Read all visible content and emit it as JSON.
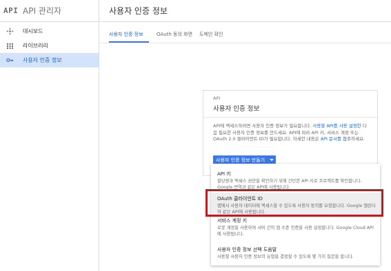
{
  "app": {
    "logo": "API",
    "title": "API 관리자"
  },
  "sidebar": {
    "items": [
      {
        "label": "대시보드",
        "icon": "dashboard-icon",
        "active": false
      },
      {
        "label": "라이브러리",
        "icon": "library-icon",
        "active": false
      },
      {
        "label": "사용자 인증 정보",
        "icon": "key-icon",
        "active": true
      }
    ]
  },
  "header": {
    "title": "사용자 인증 정보"
  },
  "tabs": [
    {
      "label": "사용자 인증 정보",
      "active": true
    },
    {
      "label": "OAuth 동의 화면",
      "active": false
    },
    {
      "label": "도메인 확인",
      "active": false
    }
  ],
  "card": {
    "kicker": "API",
    "title": "사용자 인증 정보",
    "body_pre": "API에 액세스하려면 사용자 인증 정보가 필요합니다. ",
    "body_link1": "사용할 API를 사용 설정한",
    "body_mid": " 다음 필요한 사용자 인증 정보를 만드세요. API에 따라 API 키, 서비스 계정 또는 OAuth 2.0 클라이언트 ID가 필요합니다. 자세한 내용은 ",
    "body_link2": "API 문서를 참조",
    "body_post": "하세요.",
    "create_button": "사용자 인증 정보 만들기"
  },
  "menu": {
    "items": [
      {
        "title": "API 키",
        "desc": "할당량과 액세스 권한을 확인하기 위해 간단한 API 키로 프로젝트를 확인합니다. Google 번역과 같은 API에 사용됩니다."
      },
      {
        "title": "OAuth 클라이언트 ID",
        "desc": "앱에서 사용자 데이터에 액세스할 수 있도록 사용자 동의를 요청합니다. Google 캘린더와 같은 API에 사용됩니다."
      },
      {
        "title": "서비스 계정 키",
        "desc": "로봇 계정을 사용하여 서버 간의 앱 수준 인증을 사용 설정합니다. Google Cloud API에 사용됩니다."
      },
      {
        "title": "사용자 인증 정보 선택 도움말",
        "desc": "사용할 사용자 인증 정보의 유형을 결정할 수 있도록 몇 가지 질문을 합니다."
      }
    ]
  },
  "colors": {
    "accent": "#3b78e7",
    "link": "#1a63c7",
    "sidebar_active": "#d3e3fb",
    "highlight": "#b91e23"
  }
}
